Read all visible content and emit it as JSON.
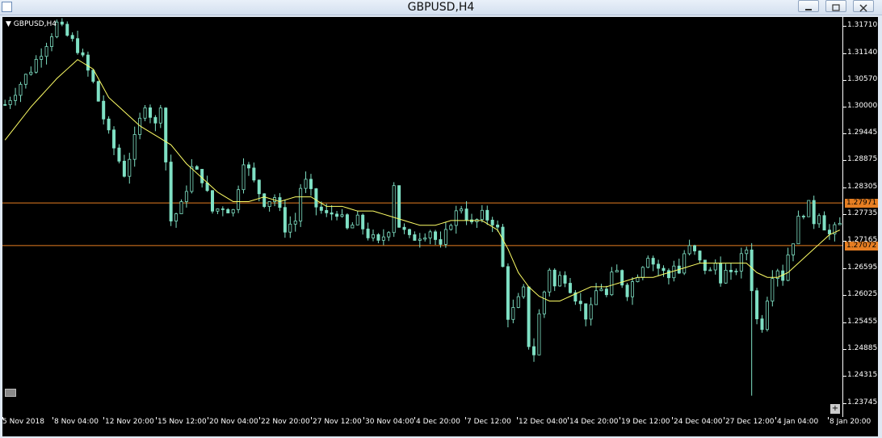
{
  "window": {
    "title": "GBPUSD,H4"
  },
  "chart": {
    "symbol_label": "GBPUSD,H4",
    "colors": {
      "background": "#000000",
      "candle": "#7fe0c4",
      "ma": "#ffff66",
      "hline": "#e67e22"
    },
    "horizontal_lines": [
      {
        "value": 1.27971,
        "label": "1.27971"
      },
      {
        "value": 1.27072,
        "label": "1.27072"
      }
    ]
  },
  "chart_data": {
    "type": "candlestick",
    "title": "GBPUSD,H4",
    "ylim": [
      1.2345,
      1.319
    ],
    "price_ticks": [
      "1.31710",
      "1.31140",
      "1.30570",
      "1.30000",
      "1.29445",
      "1.28875",
      "1.28305",
      "1.27735",
      "1.27165",
      "1.26595",
      "1.26025",
      "1.25455",
      "1.24885",
      "1.24315",
      "1.23745"
    ],
    "time_ticks": [
      "5 Nov 2018",
      "8 Nov 04:00",
      "12 Nov 20:00",
      "15 Nov 12:00",
      "20 Nov 04:00",
      "22 Nov 20:00",
      "27 Nov 12:00",
      "30 Nov 04:00",
      "4 Dec 20:00",
      "7 Dec 12:00",
      "12 Dec 04:00",
      "14 Dec 20:00",
      "19 Dec 12:00",
      "24 Dec 04:00",
      "27 Dec 12:00",
      "4 Jan 04:00",
      "8 Jan 20:00"
    ],
    "close_path": [
      [
        0,
        1.3005
      ],
      [
        5,
        1.308
      ],
      [
        10,
        1.3175
      ],
      [
        14,
        1.3125
      ],
      [
        17,
        1.305
      ],
      [
        20,
        1.294
      ],
      [
        23,
        1.286
      ],
      [
        25,
        1.293
      ],
      [
        27,
        1.301
      ],
      [
        29,
        1.296
      ],
      [
        30,
        1.301
      ],
      [
        32,
        1.276
      ],
      [
        34,
        1.279
      ],
      [
        36,
        1.287
      ],
      [
        38,
        1.285
      ],
      [
        40,
        1.278
      ],
      [
        42,
        1.279
      ],
      [
        44,
        1.278
      ],
      [
        46,
        1.289
      ],
      [
        48,
        1.284
      ],
      [
        50,
        1.28
      ],
      [
        52,
        1.281
      ],
      [
        54,
        1.2745
      ],
      [
        56,
        1.276
      ],
      [
        57,
        1.283
      ],
      [
        58,
        1.284
      ],
      [
        60,
        1.279
      ],
      [
        62,
        1.277
      ],
      [
        64,
        1.278
      ],
      [
        66,
        1.274
      ],
      [
        68,
        1.276
      ],
      [
        70,
        1.273
      ],
      [
        72,
        1.271
      ],
      [
        74,
        1.2745
      ],
      [
        75,
        1.284
      ],
      [
        76,
        1.275
      ],
      [
        78,
        1.272
      ],
      [
        80,
        1.273
      ],
      [
        82,
        1.274
      ],
      [
        84,
        1.27
      ],
      [
        86,
        1.276
      ],
      [
        88,
        1.279
      ],
      [
        90,
        1.275
      ],
      [
        92,
        1.277
      ],
      [
        94,
        1.276
      ],
      [
        95,
        1.274
      ],
      [
        96,
        1.266
      ],
      [
        97,
        1.256
      ],
      [
        98,
        1.257
      ],
      [
        99,
        1.259
      ],
      [
        100,
        1.261
      ],
      [
        101,
        1.25
      ],
      [
        102,
        1.248
      ],
      [
        103,
        1.256
      ],
      [
        104,
        1.261
      ],
      [
        105,
        1.266
      ],
      [
        106,
        1.262
      ],
      [
        107,
        1.264
      ],
      [
        108,
        1.264
      ],
      [
        109,
        1.262
      ],
      [
        110,
        1.26
      ],
      [
        111,
        1.258
      ],
      [
        112,
        1.256
      ],
      [
        113,
        1.257
      ],
      [
        114,
        1.261
      ],
      [
        115,
        1.262
      ],
      [
        116,
        1.26
      ],
      [
        117,
        1.264
      ],
      [
        118,
        1.265
      ],
      [
        119,
        1.263
      ],
      [
        120,
        1.261
      ],
      [
        121,
        1.263
      ],
      [
        122,
        1.265
      ],
      [
        123,
        1.267
      ],
      [
        124,
        1.269
      ],
      [
        125,
        1.267
      ],
      [
        126,
        1.266
      ],
      [
        127,
        1.265
      ],
      [
        128,
        1.264
      ],
      [
        129,
        1.267
      ],
      [
        130,
        1.265
      ],
      [
        131,
        1.269
      ],
      [
        132,
        1.27
      ],
      [
        133,
        1.269
      ],
      [
        134,
        1.267
      ],
      [
        135,
        1.266
      ],
      [
        136,
        1.265
      ],
      [
        137,
        1.267
      ],
      [
        138,
        1.264
      ],
      [
        139,
        1.265
      ],
      [
        140,
        1.264
      ],
      [
        141,
        1.266
      ],
      [
        142,
        1.268
      ],
      [
        143,
        1.27
      ],
      [
        144,
        1.262
      ],
      [
        145,
        1.255
      ],
      [
        146,
        1.254
      ],
      [
        147,
        1.26
      ],
      [
        148,
        1.265
      ],
      [
        149,
        1.266
      ],
      [
        150,
        1.264
      ],
      [
        151,
        1.269
      ],
      [
        152,
        1.272
      ],
      [
        153,
        1.276
      ],
      [
        154,
        1.278
      ],
      [
        155,
        1.279
      ],
      [
        156,
        1.276
      ],
      [
        157,
        1.278
      ],
      [
        158,
        1.275
      ],
      [
        159,
        1.273
      ],
      [
        160,
        1.274
      ],
      [
        161,
        1.275
      ]
    ],
    "ma_path": [
      [
        0,
        1.293
      ],
      [
        5,
        1.3
      ],
      [
        10,
        1.306
      ],
      [
        14,
        1.31
      ],
      [
        17,
        1.308
      ],
      [
        20,
        1.302
      ],
      [
        23,
        1.299
      ],
      [
        26,
        1.296
      ],
      [
        29,
        1.294
      ],
      [
        32,
        1.292
      ],
      [
        35,
        1.288
      ],
      [
        38,
        1.285
      ],
      [
        41,
        1.282
      ],
      [
        44,
        1.28
      ],
      [
        47,
        1.28
      ],
      [
        50,
        1.281
      ],
      [
        53,
        1.28
      ],
      [
        56,
        1.281
      ],
      [
        59,
        1.281
      ],
      [
        62,
        1.279
      ],
      [
        65,
        1.279
      ],
      [
        68,
        1.278
      ],
      [
        71,
        1.278
      ],
      [
        74,
        1.277
      ],
      [
        77,
        1.276
      ],
      [
        80,
        1.275
      ],
      [
        83,
        1.275
      ],
      [
        86,
        1.276
      ],
      [
        89,
        1.276
      ],
      [
        92,
        1.276
      ],
      [
        95,
        1.274
      ],
      [
        97,
        1.27
      ],
      [
        99,
        1.265
      ],
      [
        101,
        1.262
      ],
      [
        103,
        1.26
      ],
      [
        105,
        1.259
      ],
      [
        107,
        1.259
      ],
      [
        109,
        1.26
      ],
      [
        111,
        1.261
      ],
      [
        113,
        1.262
      ],
      [
        116,
        1.262
      ],
      [
        119,
        1.263
      ],
      [
        122,
        1.264
      ],
      [
        125,
        1.264
      ],
      [
        128,
        1.265
      ],
      [
        131,
        1.266
      ],
      [
        134,
        1.267
      ],
      [
        137,
        1.267
      ],
      [
        140,
        1.267
      ],
      [
        143,
        1.267
      ],
      [
        145,
        1.265
      ],
      [
        147,
        1.264
      ],
      [
        149,
        1.264
      ],
      [
        151,
        1.265
      ],
      [
        153,
        1.267
      ],
      [
        155,
        1.269
      ],
      [
        157,
        1.271
      ],
      [
        159,
        1.273
      ],
      [
        161,
        1.274
      ]
    ],
    "bar_count": 162,
    "spike_low": {
      "index": 144,
      "value": 1.239
    }
  }
}
